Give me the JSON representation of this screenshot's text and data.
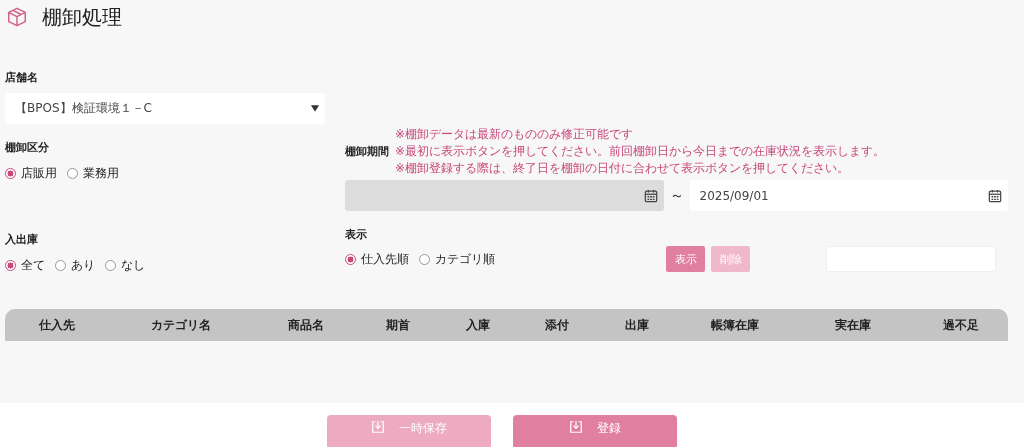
{
  "title": "棚卸処理",
  "store": {
    "label": "店舗名",
    "value": "【BPOS】検証環境１－C"
  },
  "category": {
    "label": "棚卸区分",
    "options": [
      {
        "label": "店販用",
        "selected": true
      },
      {
        "label": "業務用",
        "selected": false
      }
    ]
  },
  "period": {
    "label": "棚卸期間",
    "notes": [
      "※棚卸データは最新のもののみ修正可能です",
      "※最初に表示ボタンを押してください。前回棚卸日から今日までの在庫状況を表示します。",
      "※棚卸登録する際は、終了日を棚卸の日付に合わせて表示ボタンを押してください。"
    ],
    "start": {
      "disabled": true
    },
    "separator": "～",
    "end": {
      "value": "2025/09/01",
      "disabled": false
    }
  },
  "inout": {
    "label": "入出庫",
    "options": [
      {
        "label": "全て",
        "selected": true
      },
      {
        "label": "あり",
        "selected": false
      },
      {
        "label": "なし",
        "selected": false
      }
    ]
  },
  "display": {
    "label": "表示",
    "options": [
      {
        "label": "仕入先順",
        "selected": true
      },
      {
        "label": "カテゴリ順",
        "selected": false
      }
    ]
  },
  "actions": [
    {
      "label": "表示",
      "disabled": false
    },
    {
      "label": "削除",
      "disabled": true
    }
  ],
  "table": {
    "columns": [
      "仕入先",
      "カテゴリ名",
      "商品名",
      "期首",
      "入庫",
      "添付",
      "出庫",
      "帳簿在庫",
      "実在庫",
      "過不足"
    ]
  },
  "footer_buttons": [
    {
      "label": "一時保存",
      "disabled": true
    },
    {
      "label": "登録",
      "disabled": false
    }
  ]
}
